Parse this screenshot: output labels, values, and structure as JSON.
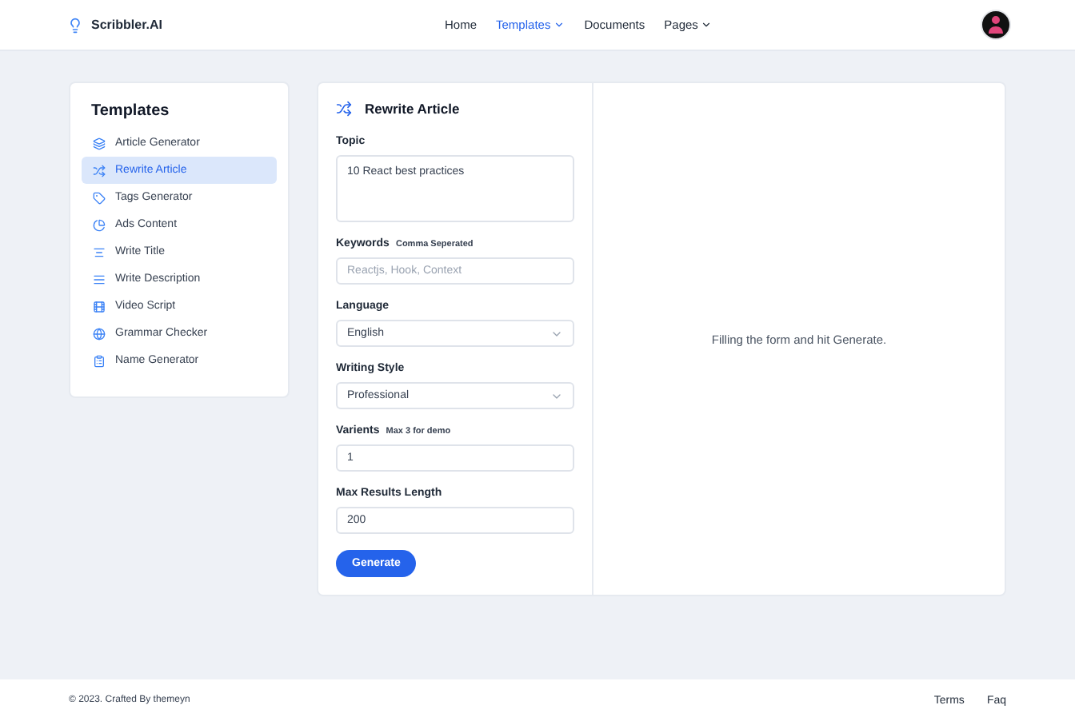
{
  "brand": "Scribbler.AI",
  "nav": [
    {
      "label": "Home",
      "selected": false,
      "dropdown": false
    },
    {
      "label": "Templates",
      "selected": true,
      "dropdown": true
    },
    {
      "label": "Documents",
      "selected": false,
      "dropdown": false
    },
    {
      "label": "Pages",
      "selected": false,
      "dropdown": true
    }
  ],
  "sidebar": {
    "title": "Templates",
    "items": [
      {
        "label": "Article Generator",
        "kind": "layers",
        "selected": false
      },
      {
        "label": "Rewrite Article",
        "kind": "shuffle",
        "selected": true
      },
      {
        "label": "Tags Generator",
        "kind": "tag",
        "selected": false
      },
      {
        "label": "Ads Content",
        "kind": "pie",
        "selected": false
      },
      {
        "label": "Write Title",
        "kind": "title",
        "selected": false
      },
      {
        "label": "Write Description",
        "kind": "lines",
        "selected": false
      },
      {
        "label": "Video Script",
        "kind": "video",
        "selected": false
      },
      {
        "label": "Grammar Checker",
        "kind": "globe",
        "selected": false
      },
      {
        "label": "Name Generator",
        "kind": "clipboard",
        "selected": false
      }
    ]
  },
  "form": {
    "title": "Rewrite Article",
    "fields": [
      {
        "label": "Topic",
        "kind": "textarea",
        "value": "10 React best practices"
      },
      {
        "label": "Keywords",
        "hint": "Comma Seperated",
        "kind": "input",
        "placeholder": "Reactjs, Hook, Context"
      },
      {
        "label": "Language",
        "kind": "select",
        "value": "English"
      },
      {
        "label": "Writing Style",
        "kind": "select",
        "value": "Professional"
      },
      {
        "label": "Varients",
        "hint": "Max 3 for demo",
        "kind": "input",
        "value": "1"
      },
      {
        "label": "Max Results Length",
        "kind": "input",
        "value": "200"
      }
    ],
    "button": "Generate"
  },
  "result": {
    "message": "Filling the form and hit Generate."
  },
  "footer": {
    "copyright": "© 2023. Crafted By themeyn",
    "links": [
      "Terms",
      "Faq"
    ]
  }
}
